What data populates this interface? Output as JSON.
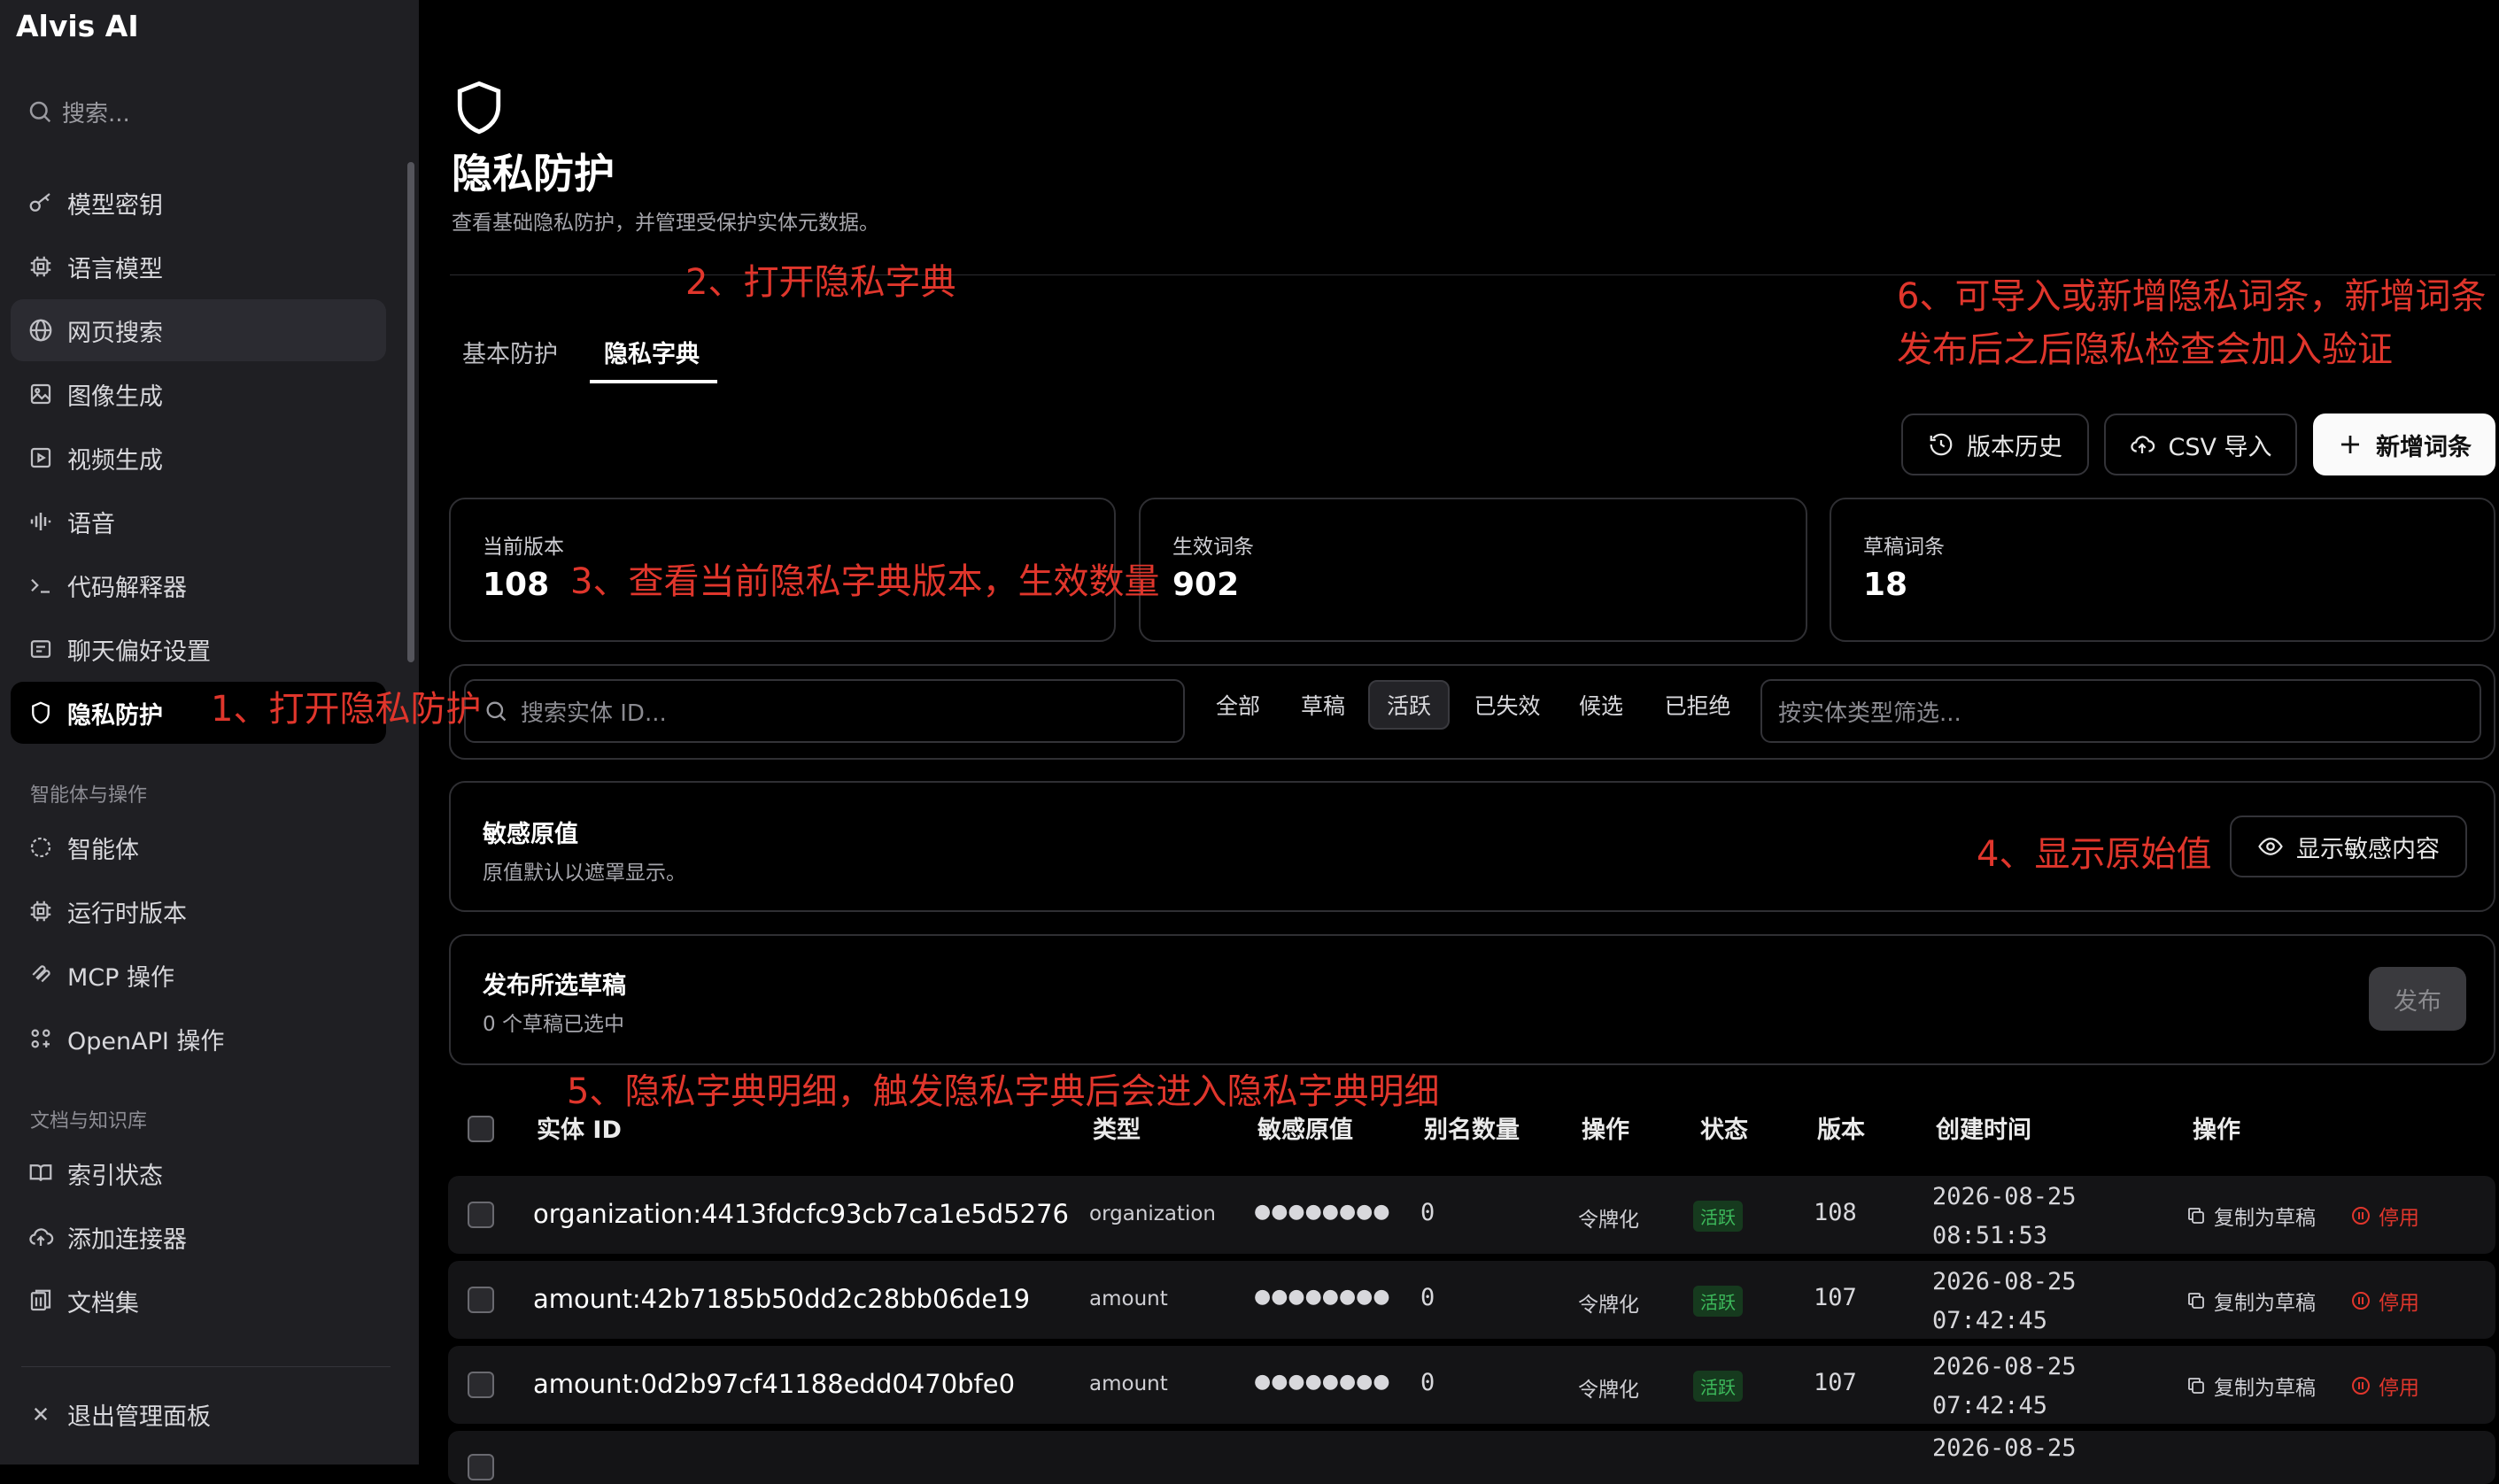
{
  "app": {
    "title": "Alvis AI"
  },
  "sidebar": {
    "search_placeholder": "搜索...",
    "items": [
      {
        "label": "模型密钥",
        "icon": "key-icon"
      },
      {
        "label": "语言模型",
        "icon": "cpu-icon"
      },
      {
        "label": "网页搜索",
        "icon": "globe-icon"
      },
      {
        "label": "图像生成",
        "icon": "image-icon"
      },
      {
        "label": "视频生成",
        "icon": "video-icon"
      },
      {
        "label": "语音",
        "icon": "waveform-icon"
      },
      {
        "label": "代码解释器",
        "icon": "terminal-icon"
      },
      {
        "label": "聊天偏好设置",
        "icon": "message-icon"
      },
      {
        "label": "隐私防护",
        "icon": "shield-icon"
      }
    ],
    "section_agents": "智能体与操作",
    "agent_items": [
      {
        "label": "智能体",
        "icon": "agent-icon"
      },
      {
        "label": "运行时版本",
        "icon": "cpu-icon"
      },
      {
        "label": "MCP 操作",
        "icon": "mcp-icon"
      },
      {
        "label": "OpenAPI 操作",
        "icon": "api-icon"
      }
    ],
    "section_docs": "文档与知识库",
    "doc_items": [
      {
        "label": "索引状态",
        "icon": "book-icon"
      },
      {
        "label": "添加连接器",
        "icon": "cloud-upload-icon"
      },
      {
        "label": "文档集",
        "icon": "files-icon"
      }
    ],
    "exit_label": "退出管理面板"
  },
  "page": {
    "title": "隐私防护",
    "subtitle": "查看基础隐私防护，并管理受保护实体元数据。",
    "tabs": [
      "基本防护",
      "隐私字典"
    ],
    "active_tab": "隐私字典"
  },
  "toolbar": {
    "history": "版本历史",
    "csv_import": "CSV 导入",
    "add_entry": "新增词条"
  },
  "stats": [
    {
      "label": "当前版本",
      "value": "108"
    },
    {
      "label": "生效词条",
      "value": "902"
    },
    {
      "label": "草稿词条",
      "value": "18"
    }
  ],
  "filters": {
    "search_placeholder": "搜索实体 ID...",
    "status": [
      "全部",
      "草稿",
      "活跃",
      "已失效",
      "候选",
      "已拒绝"
    ],
    "selected": "活跃",
    "type_placeholder": "按实体类型筛选..."
  },
  "sensitive": {
    "title": "敏感原值",
    "desc": "原值默认以遮罩显示。",
    "button": "显示敏感内容"
  },
  "publish": {
    "title": "发布所选草稿",
    "desc": "0 个草稿已选中",
    "button": "发布"
  },
  "table": {
    "headers": [
      "实体 ID",
      "类型",
      "敏感原值",
      "别名数量",
      "操作",
      "状态",
      "版本",
      "创建时间",
      "操作"
    ],
    "rows": [
      {
        "id": "organization:4413fdcfc93cb7ca1e5d5276",
        "type": "organization",
        "masked": "●●●●●●●●",
        "aliases": "0",
        "op": "令牌化",
        "status": "活跃",
        "version": "108",
        "date": "2026-08-25",
        "time": "08:51:53",
        "copy": "复制为草稿",
        "disable": "停用"
      },
      {
        "id": "amount:42b7185b50dd2c28bb06de19",
        "type": "amount",
        "masked": "●●●●●●●●",
        "aliases": "0",
        "op": "令牌化",
        "status": "活跃",
        "version": "107",
        "date": "2026-08-25",
        "time": "07:42:45",
        "copy": "复制为草稿",
        "disable": "停用"
      },
      {
        "id": "amount:0d2b97cf41188edd0470bfe0",
        "type": "amount",
        "masked": "●●●●●●●●",
        "aliases": "0",
        "op": "令牌化",
        "status": "活跃",
        "version": "107",
        "date": "2026-08-25",
        "time": "07:42:45",
        "copy": "复制为草稿",
        "disable": "停用"
      },
      {
        "id": "",
        "type": "",
        "masked": "",
        "aliases": "",
        "op": "",
        "status": "",
        "version": "",
        "date": "2026-08-25",
        "time": "",
        "copy": "",
        "disable": ""
      }
    ]
  },
  "annotations": {
    "a1": "1、打开隐私防护",
    "a2": "2、打开隐私字典",
    "a3": "3、查看当前隐私字典版本，生效数量",
    "a4": "4、显示原始值",
    "a5": "5、隐私字典明细，触发隐私字典后会进入隐私字典明细",
    "a6_line1": "6、可导入或新增隐私词条，新增词条",
    "a6_line2": "发布后之后隐私检查会加入验证"
  },
  "colors": {
    "annotation": "#e0362c",
    "active_badge_text": "#3dbb5c",
    "active_badge_bg": "#163a1e",
    "disable": "#e0362c"
  }
}
